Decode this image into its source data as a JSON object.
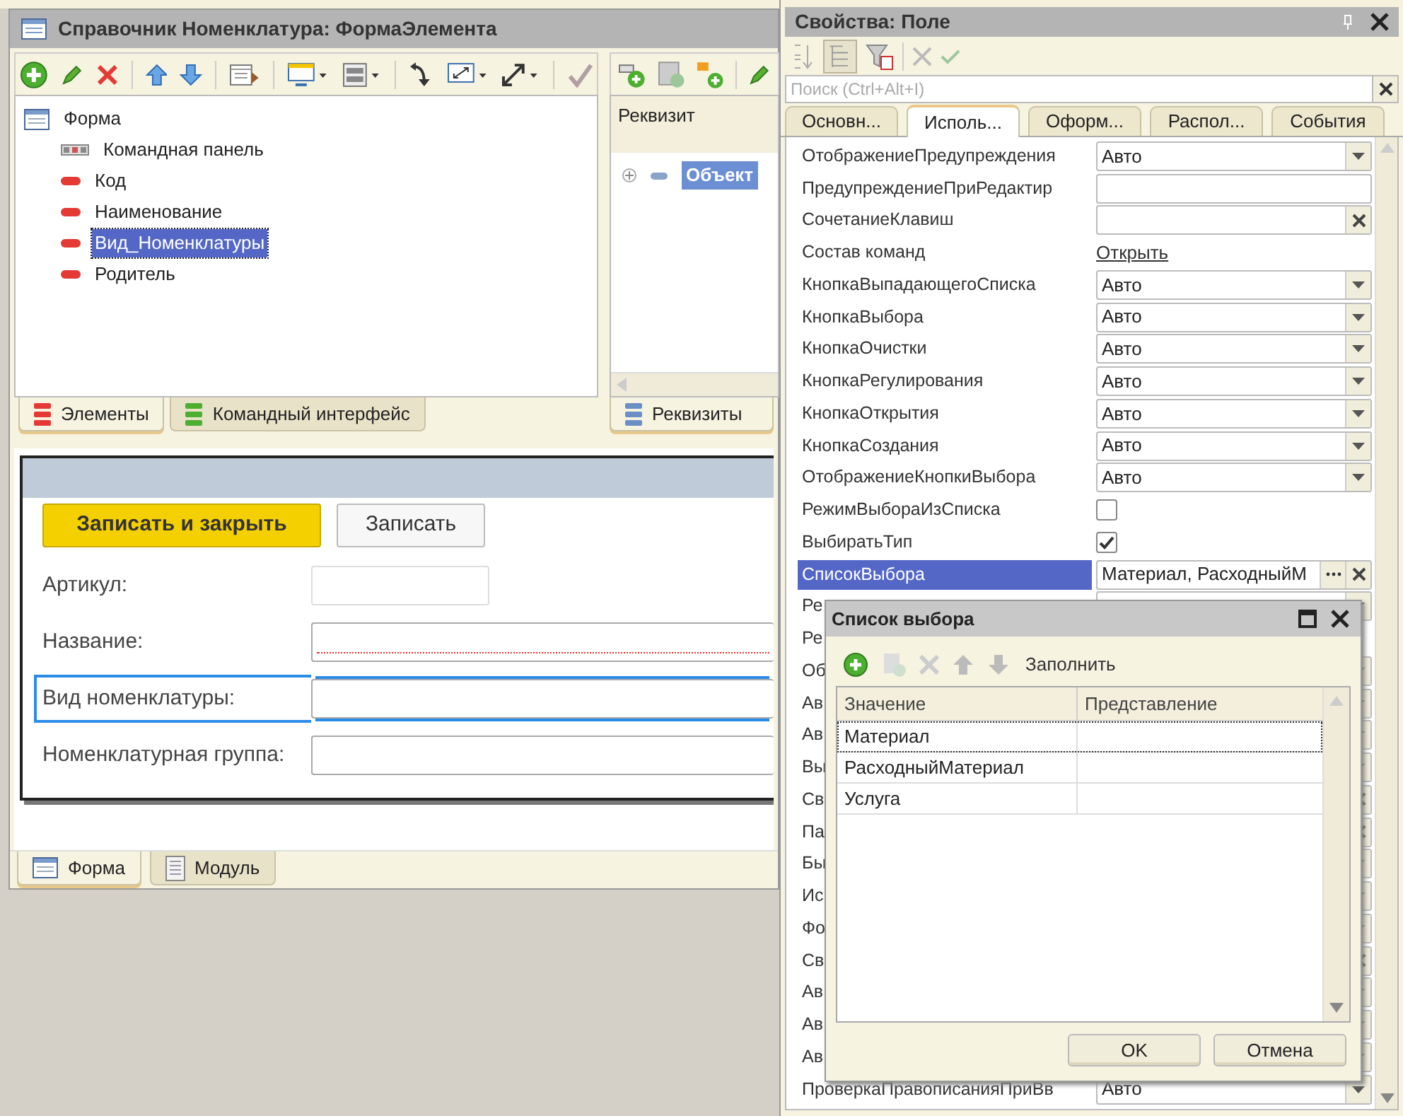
{
  "designer": {
    "title": "Справочник Номенклатура: ФормаЭлемента",
    "tree": [
      {
        "label": "Форма",
        "kind": "form",
        "selected": false,
        "children": [
          {
            "label": "Командная панель",
            "kind": "command_bar",
            "selected": false
          },
          {
            "label": "Код",
            "kind": "field",
            "selected": false
          },
          {
            "label": "Наименование",
            "kind": "field",
            "selected": false
          },
          {
            "label": "Вид_Номенклатуры",
            "kind": "field",
            "selected": true
          },
          {
            "label": "Родитель",
            "kind": "field",
            "selected": false
          }
        ]
      }
    ],
    "tree_tabs": [
      {
        "label": "Элементы",
        "kind": "elements",
        "selected": true
      },
      {
        "label": "Командный интерфейс",
        "kind": "commands",
        "selected": false
      }
    ],
    "attributes": {
      "header": "Реквизит",
      "items": [
        {
          "label": "Объект",
          "selected": true
        }
      ],
      "tabs": [
        {
          "label": "Реквизиты",
          "selected": true
        }
      ]
    },
    "form_preview": {
      "buttons": [
        {
          "label": "Записать и закрыть",
          "default": true
        },
        {
          "label": "Записать",
          "default": false
        }
      ],
      "fields": [
        {
          "label": "Артикул:",
          "kind": "short",
          "required": false,
          "focused": false
        },
        {
          "label": "Название:",
          "kind": "wide",
          "required": true,
          "focused": false
        },
        {
          "label": "Вид номенклатуры:",
          "kind": "wide",
          "required": false,
          "focused": true
        },
        {
          "label": "Номенклатурная группа:",
          "kind": "wide",
          "required": false,
          "focused": false
        }
      ]
    },
    "bottom_tabs": [
      {
        "label": "Форма",
        "kind": "form",
        "selected": true
      },
      {
        "label": "Модуль",
        "kind": "module",
        "selected": false
      }
    ]
  },
  "properties": {
    "title": "Свойства: Поле",
    "search": {
      "placeholder": "Поиск (Ctrl+Alt+I)"
    },
    "tabs": [
      {
        "label": "Основн...",
        "selected": false
      },
      {
        "label": "Исполь...",
        "selected": true
      },
      {
        "label": "Оформ...",
        "selected": false
      },
      {
        "label": "Распол...",
        "selected": false
      },
      {
        "label": "События",
        "selected": false
      }
    ],
    "rows": [
      {
        "label": "ОтображениеПредупреждения",
        "kind": "dropdown",
        "value": "Авто",
        "selected": false
      },
      {
        "label": "ПредупреждениеПриРедактир",
        "kind": "text",
        "selected": false
      },
      {
        "label": "СочетаниеКлавиш",
        "kind": "clear",
        "selected": false
      },
      {
        "label": "Состав команд",
        "kind": "link",
        "value": "Открыть",
        "selected": false
      },
      {
        "label": "КнопкаВыпадающегоСписка",
        "kind": "dropdown",
        "value": "Авто",
        "selected": false
      },
      {
        "label": "КнопкаВыбора",
        "kind": "dropdown",
        "value": "Авто",
        "selected": false
      },
      {
        "label": "КнопкаОчистки",
        "kind": "dropdown",
        "value": "Авто",
        "selected": false
      },
      {
        "label": "КнопкаРегулирования",
        "kind": "dropdown",
        "value": "Авто",
        "selected": false
      },
      {
        "label": "КнопкаОткрытия",
        "kind": "dropdown",
        "value": "Авто",
        "selected": false
      },
      {
        "label": "КнопкаСоздания",
        "kind": "dropdown",
        "value": "Авто",
        "selected": false
      },
      {
        "label": "ОтображениеКнопкиВыбора",
        "kind": "dropdown",
        "value": "Авто",
        "selected": false
      },
      {
        "label": "РежимВыбораИзСписка",
        "kind": "checkbox",
        "checked": false,
        "selected": false
      },
      {
        "label": "ВыбиратьТип",
        "kind": "checkbox",
        "checked": true,
        "selected": false
      },
      {
        "label": "СписокВыбора",
        "kind": "picker",
        "value": "Материал, РасходныйМ",
        "selected": true
      },
      {
        "label": "Ре",
        "kind": "dropdown",
        "selected": false
      },
      {
        "label": "Ре",
        "kind": "none",
        "selected": false
      },
      {
        "label": "Об",
        "kind": "dropdown",
        "selected": false
      },
      {
        "label": "Ав",
        "kind": "dropdown",
        "selected": false
      },
      {
        "label": "Ав",
        "kind": "dropdown",
        "selected": false
      },
      {
        "label": "Вы",
        "kind": "dropdown",
        "selected": false
      },
      {
        "label": "Св",
        "kind": "clear",
        "selected": false
      },
      {
        "label": "Па",
        "kind": "clear",
        "selected": false
      },
      {
        "label": "Бы",
        "kind": "dropdown",
        "selected": false
      },
      {
        "label": "Ис",
        "kind": "dropdown",
        "selected": false
      },
      {
        "label": "Фо",
        "kind": "dropdown",
        "selected": false
      },
      {
        "label": "Св",
        "kind": "clear",
        "selected": false
      },
      {
        "label": "Ав",
        "kind": "dropdown",
        "selected": false
      },
      {
        "label": "Ав",
        "kind": "dropdown",
        "selected": false
      },
      {
        "label": "Ав",
        "kind": "dropdown",
        "selected": false
      },
      {
        "label": "ПроверкаПравописанияПриВв",
        "kind": "dropdown",
        "value": "Авто",
        "selected": false
      }
    ]
  },
  "choice_list_dialog": {
    "title": "Список выбора",
    "toolbar_label": "Заполнить",
    "columns": [
      "Значение",
      "Представление"
    ],
    "rows": [
      {
        "value": "Материал",
        "selected": true
      },
      {
        "value": "РасходныйМатериал",
        "selected": false
      },
      {
        "value": "Услуга",
        "selected": false
      }
    ],
    "buttons": [
      "OK",
      "Отмена"
    ]
  }
}
